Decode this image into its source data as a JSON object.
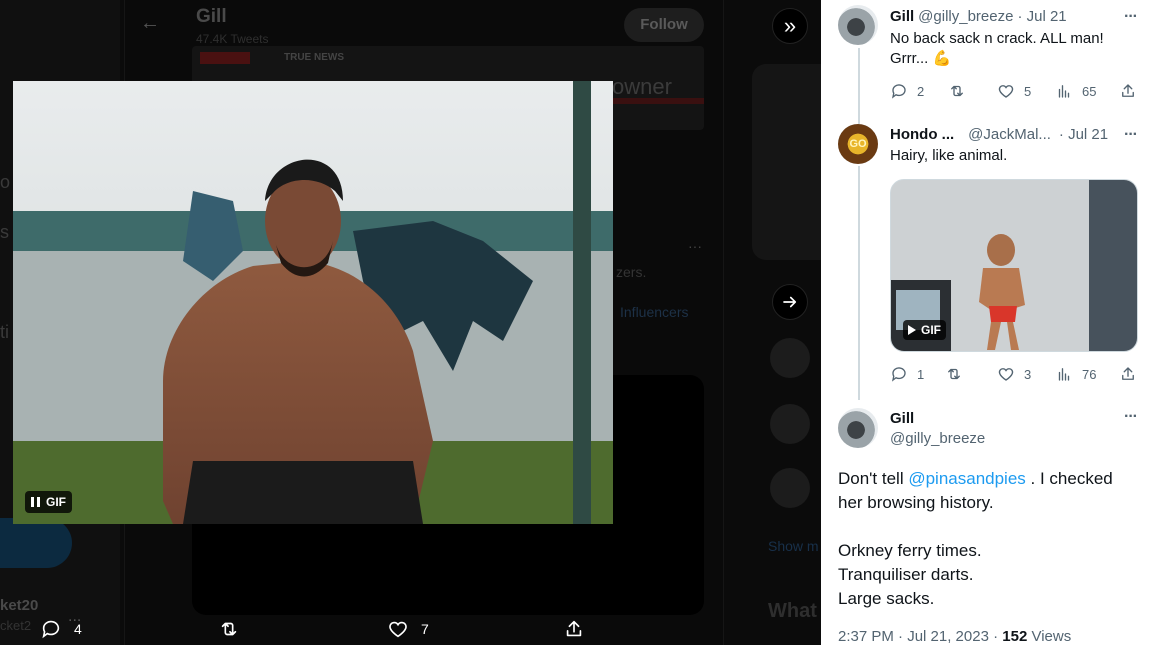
{
  "background": {
    "left_nav": {
      "letters": [
        "o",
        "s",
        "ti"
      ],
      "user_name": "ket20",
      "user_handle": "cket2",
      "more_label": "..."
    },
    "profile": {
      "name": "Gill",
      "tweet_count": "47.4K Tweets",
      "follow_label": "Follow"
    },
    "banner": {
      "label": "TRUE NEWS",
      "word": "owner"
    },
    "partial_texts": [
      "zers.",
      "Influencers"
    ],
    "sidebar": {
      "heading_fragment": "What",
      "show_more_fragment": "Show m"
    }
  },
  "media_viewer": {
    "gif_label": "GIF",
    "actions": {
      "reply_count": "4",
      "retweet_count": "",
      "like_count": "7"
    }
  },
  "conversation": {
    "replies": [
      {
        "name": "Gill",
        "handle": "@gilly_breeze",
        "date": "· Jul 21",
        "text_line1": "No back sack n crack. ALL man!",
        "text_line2": "Grrr... 💪",
        "reply_count": "2",
        "retweet_count": "",
        "like_count": "5",
        "view_count": "65"
      },
      {
        "name": "Hondo ...",
        "handle": "@JackMal...",
        "date": "· Jul 21",
        "avatar_text": "GO",
        "text_line1": "Hairy, like animal.",
        "gif_label": "GIF",
        "reply_count": "1",
        "retweet_count": "",
        "like_count": "3",
        "view_count": "76"
      }
    ],
    "main_tweet": {
      "name": "Gill",
      "handle": "@gilly_breeze",
      "text_pre": "Don't tell",
      "mention": "@pinasandpies",
      "text_post": ". I checked her browsing history.",
      "lines": [
        "Orkney ferry times.",
        "Tranquiliser darts.",
        "Large sacks."
      ],
      "timestamp": "2:37 PM · Jul 21, 2023 ·",
      "views_count": "152",
      "views_label": "Views"
    }
  },
  "colors": {
    "link": "#1d9bf0",
    "secondary_text": "#536471",
    "primary_text": "#0f1419"
  }
}
